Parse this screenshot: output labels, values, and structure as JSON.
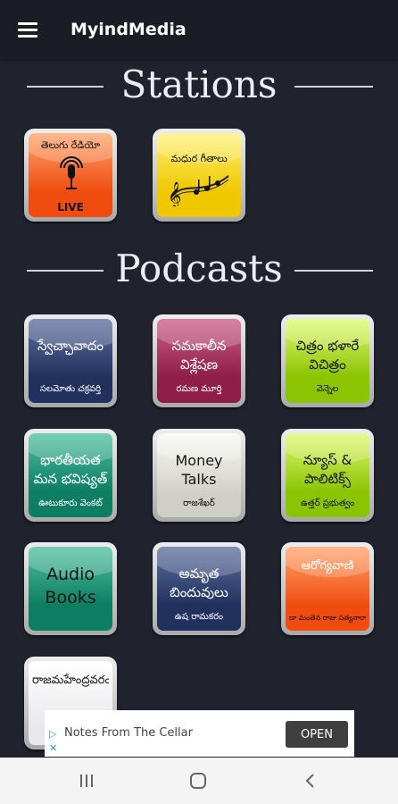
{
  "app": {
    "title": "MyindMedia",
    "menu_icon": "hamburger-menu-icon"
  },
  "stations": {
    "heading": "Stations",
    "tiles": [
      {
        "line1": "తెలుగు రేడియో",
        "line2": "LIVE",
        "icon": "microphone-broadcast-icon",
        "color": "#f46a2c"
      },
      {
        "line1": "మధుర గీతాలు",
        "line2": "",
        "icon": "music-notes-icon",
        "color": "#f7d400"
      }
    ]
  },
  "podcasts": {
    "heading": "Podcasts",
    "tiles": [
      {
        "line1": "స్వేచ్ఛావాదం",
        "line2": "సలమోతు చక్రవర్తి",
        "color": "#2f3f72"
      },
      {
        "line1": "సమకాలీన విశ్లేషణ",
        "line2": "రమణ మూర్తి",
        "color": "#a63058"
      },
      {
        "line1": "చిత్రం భళారే విచిత్రం",
        "line2": "వెన్నెల",
        "color": "#a6d81a"
      },
      {
        "line1": "భారతీయత మన భవిష్యత్",
        "line2": "ఊటుకూరు వెంకట్",
        "color": "#1f7a6a"
      },
      {
        "line1": "Money Talks",
        "line2": "రాజశేఖర్",
        "color": "#e4e4dc"
      },
      {
        "line1": "న్యూస్ & పాలిటిక్స్",
        "line2": "ఉత్తర్ ప్రభుత్వం",
        "color": "#a6d81a"
      },
      {
        "line1": "Audio Books",
        "line2": "",
        "color": "#1e9676"
      },
      {
        "line1": "అమృత బిందువులు",
        "line2": "ఉష రామకరం",
        "color": "#2f3f72"
      },
      {
        "line1": "ఆరోగ్యవాణి",
        "line2": "డా మంతెన రాజు సత్యనారాయణ",
        "color": "#f46a2c"
      },
      {
        "line1": "రాజమహేంద్రవరం",
        "line2": "",
        "color": "#f4f4f6"
      }
    ]
  },
  "ad": {
    "text": "Notes From The Cellar",
    "button": "OPEN",
    "adchoices_icon": "adchoices-icon",
    "close_icon": "close-x-icon"
  },
  "navbar": {
    "recents_icon": "recent-apps-icon",
    "home_icon": "home-icon",
    "back_icon": "back-icon"
  }
}
